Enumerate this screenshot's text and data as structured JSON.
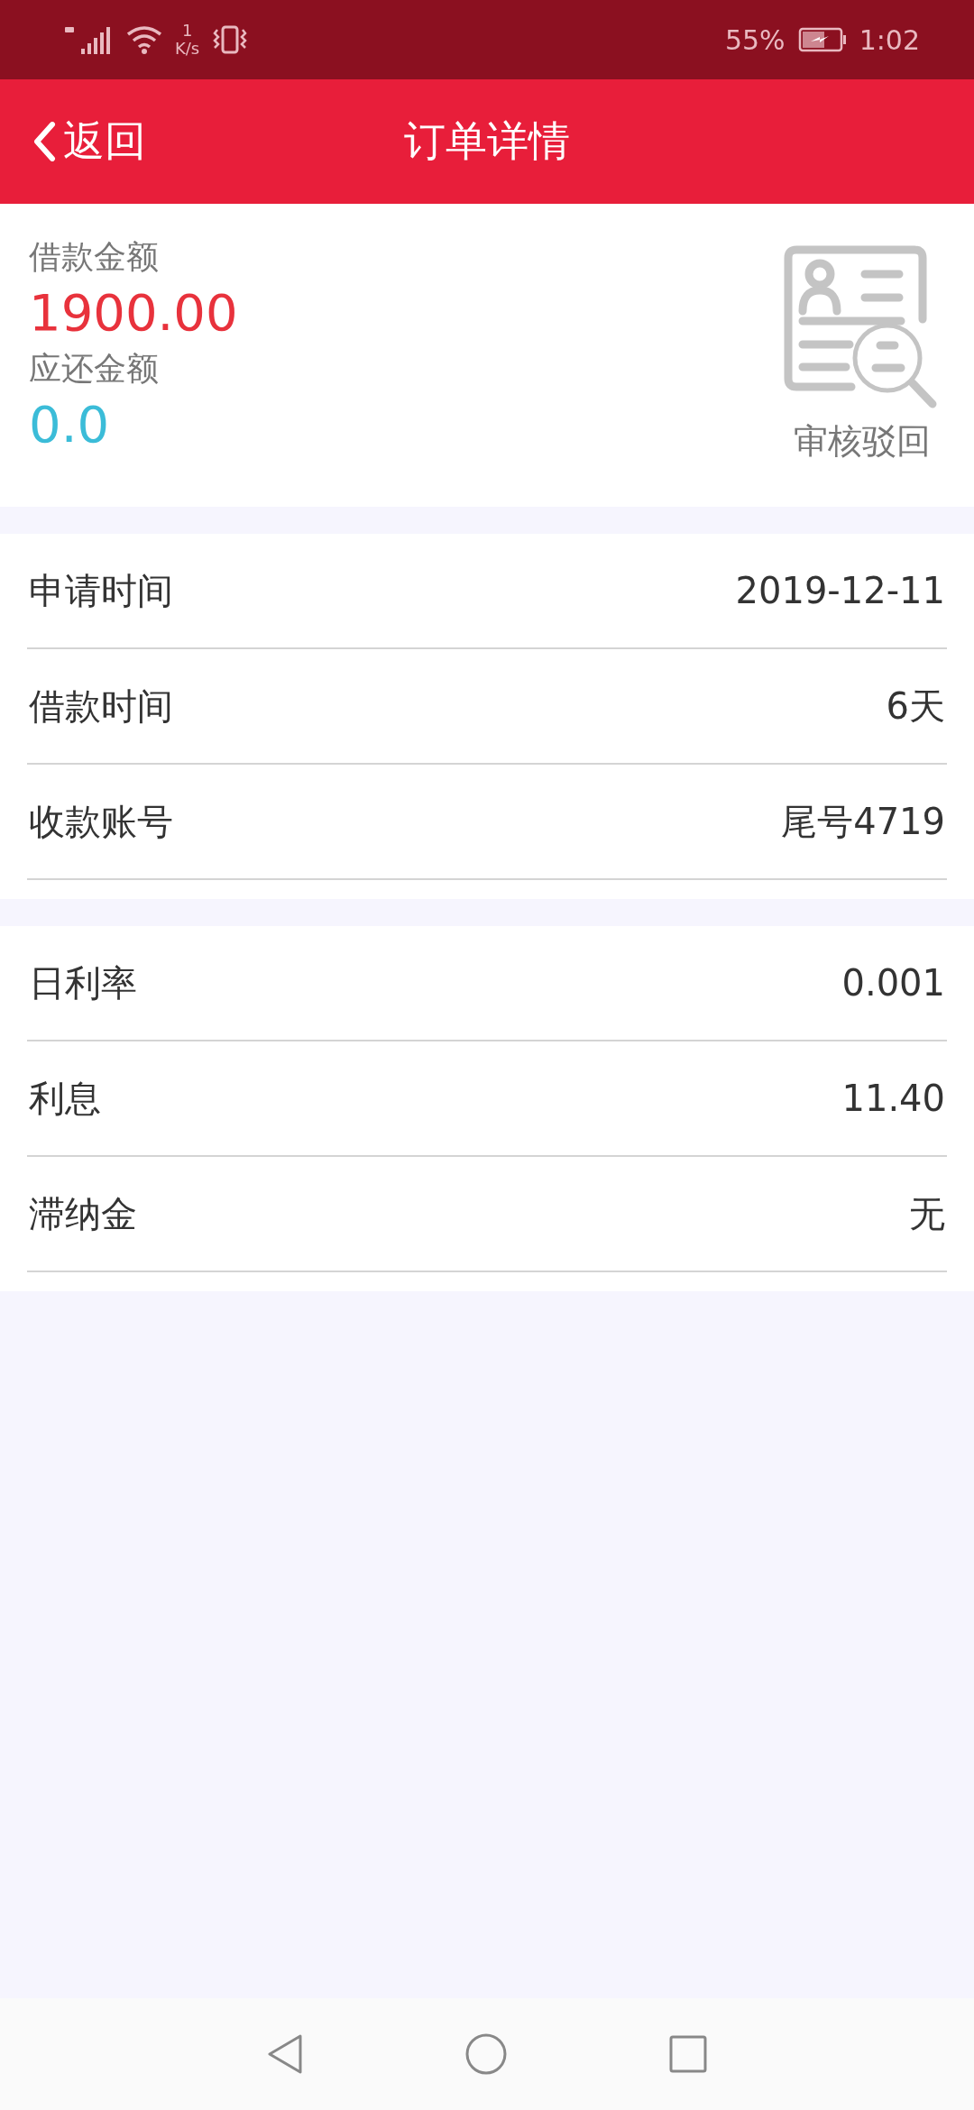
{
  "status_bar": {
    "speed_value": "1",
    "speed_unit": "K/s",
    "battery": "55%",
    "time": "1:02"
  },
  "header": {
    "back": "返回",
    "title": "订单详情"
  },
  "summary": {
    "items": [
      {
        "label": "借款金额",
        "value": "1900.00",
        "color": "#e8323c"
      },
      {
        "label": "应还金额",
        "value": "0.0",
        "color": "#3bbcd8"
      }
    ],
    "status": "审核驳回"
  },
  "sections": [
    {
      "rows": [
        {
          "label": "申请时间",
          "value": "2019-12-11"
        },
        {
          "label": "借款时间",
          "value": "6天"
        },
        {
          "label": "收款账号",
          "value": "尾号4719"
        }
      ]
    },
    {
      "rows": [
        {
          "label": "日利率",
          "value": "0.001"
        },
        {
          "label": "利息",
          "value": "11.40"
        },
        {
          "label": "滞纳金",
          "value": "无"
        }
      ]
    }
  ]
}
